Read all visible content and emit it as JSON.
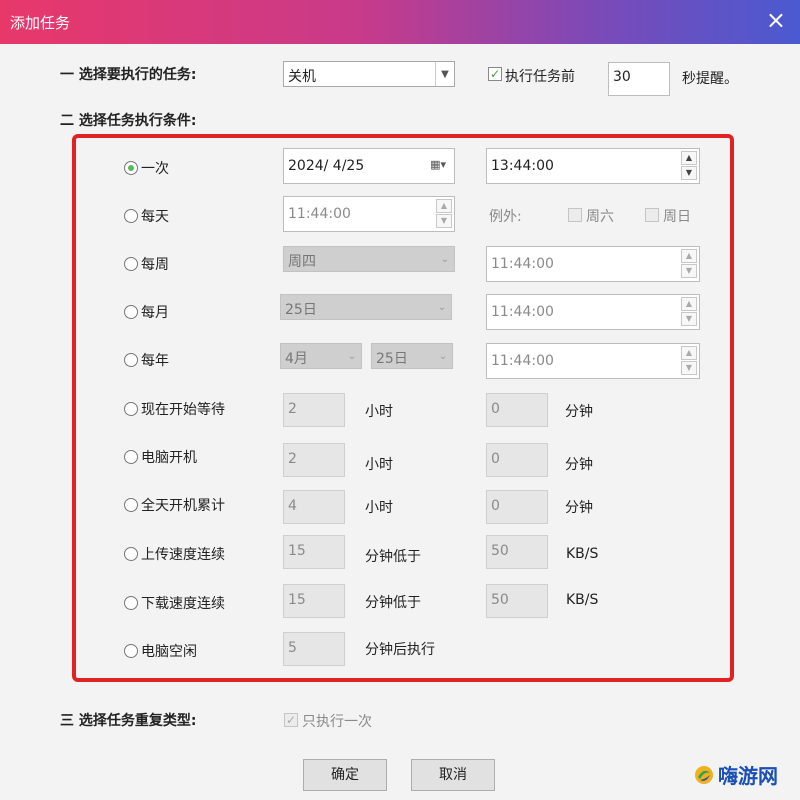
{
  "window": {
    "title": "添加任务",
    "close_icon": "×"
  },
  "section1": {
    "label": "一 选择要执行的任务:",
    "task_select": "关机",
    "remind_check_label": "执行任务前",
    "remind_seconds": "30",
    "remind_suffix": "秒提醒。"
  },
  "section2": {
    "label": "二 选择任务执行条件:"
  },
  "conditions": {
    "once": {
      "label": "一次",
      "date": "2024/  4/25",
      "time": "13:44:00"
    },
    "daily": {
      "label": "每天",
      "time": "11:44:00",
      "except_label": "例外:",
      "sat": "周六",
      "sun": "周日"
    },
    "weekly": {
      "label": "每周",
      "day": "周四",
      "time": "11:44:00"
    },
    "monthly": {
      "label": "每月",
      "day": "25日",
      "time": "11:44:00"
    },
    "yearly": {
      "label": "每年",
      "month": "4月",
      "day": "25日",
      "time": "11:44:00"
    },
    "wait": {
      "label": "现在开始等待",
      "hours": "2",
      "hours_unit": "小时",
      "minutes": "0",
      "minutes_unit": "分钟"
    },
    "poweron": {
      "label": "电脑开机",
      "hours": "2",
      "hours_unit": "小时",
      "minutes": "0",
      "minutes_unit": "分钟"
    },
    "uptime": {
      "label": "全天开机累计",
      "hours": "4",
      "hours_unit": "小时",
      "minutes": "0",
      "minutes_unit": "分钟"
    },
    "upload": {
      "label": "上传速度连续",
      "minutes": "15",
      "below_label": "分钟低于",
      "speed": "50",
      "unit": "KB/S"
    },
    "download": {
      "label": "下载速度连续",
      "minutes": "15",
      "below_label": "分钟低于",
      "speed": "50",
      "unit": "KB/S"
    },
    "idle": {
      "label": "电脑空闲",
      "minutes": "5",
      "after_label": "分钟后执行"
    }
  },
  "section3": {
    "label": "三 选择任务重复类型:",
    "once_only_label": "只执行一次"
  },
  "buttons": {
    "ok": "确定",
    "cancel": "取消"
  },
  "watermark": {
    "text": "嗨游网"
  },
  "colors": {
    "accent_red": "#e02222",
    "radio_on": "#5cb85c"
  }
}
